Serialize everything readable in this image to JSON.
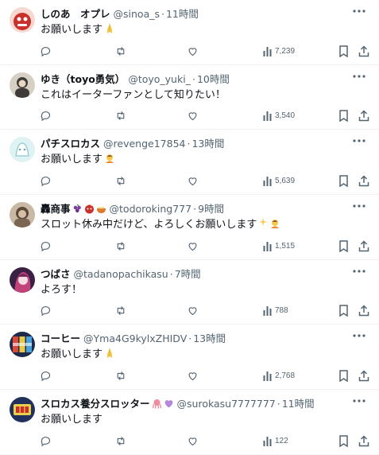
{
  "replies": [
    {
      "display_name": "しのあ　オプレ",
      "handle": "@sinoa_s",
      "time": "11時間",
      "text": "お願いします",
      "views": "7,239",
      "avatar_colors": [
        "#f6d8d0",
        "#c8312c"
      ]
    },
    {
      "display_name": "ゆき（toyo勇気）",
      "handle": "@toyo_yuki_",
      "time": "10時間",
      "text": "これはイーターファンとして知りたい！",
      "views": "3,540",
      "avatar_colors": [
        "#d6cfc4",
        "#3e3a38"
      ]
    },
    {
      "display_name": "パチスロカス",
      "handle": "@revenge17854",
      "time": "13時間",
      "text": "お願いします",
      "views": "5,639",
      "avatar_colors": [
        "#dff3f4",
        "#9ccfd6"
      ]
    },
    {
      "display_name": "轟商事",
      "handle": "@todoroking777",
      "time": "9時間",
      "text": "スロット休み中だけど、よろしくお願いします",
      "views": "1,515",
      "avatar_colors": [
        "#c9b8a4",
        "#5b4a3c"
      ]
    },
    {
      "display_name": "つばさ",
      "handle": "@tadanopachikasu",
      "time": "7時間",
      "text": "よろす！",
      "views": "788",
      "avatar_colors": [
        "#3a2044",
        "#c2427a"
      ]
    },
    {
      "display_name": "コーヒー",
      "handle": "@Yma4G9kylxZHIDV",
      "time": "13時間",
      "text": "お願いします",
      "views": "2,768",
      "avatar_colors": [
        "#1e2a4a",
        "#d94a3a"
      ]
    },
    {
      "display_name": "スロカス養分スロッター",
      "handle": "@surokasu7777777",
      "time": "11時間",
      "text": "お願いします",
      "views": "122",
      "avatar_colors": [
        "#22305c",
        "#e8d04a"
      ]
    }
  ],
  "icons": {
    "more": "more-horizontal-icon",
    "reply": "reply-icon",
    "retweet": "retweet-icon",
    "like": "heart-icon",
    "views": "views-chart-icon",
    "bookmark": "bookmark-icon",
    "share": "share-icon"
  },
  "colors": {
    "text": "#0f1419",
    "secondary": "#536471",
    "divider": "#eff3f4"
  }
}
